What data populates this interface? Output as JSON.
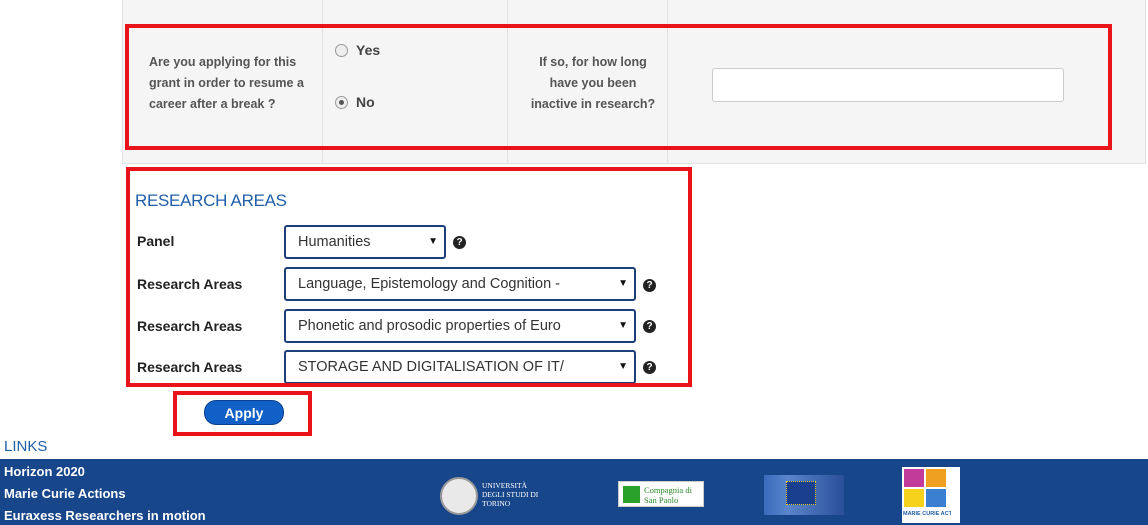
{
  "career_break": {
    "question": "Are you applying for this grant in order to resume a career after a break ?",
    "option_yes": "Yes",
    "option_no": "No",
    "selected": "No",
    "inactive_question": "If so, for how long have you been inactive in research?",
    "inactive_value": ""
  },
  "research_areas": {
    "heading": "RESEARCH AREAS",
    "panel_label": "Panel",
    "panel_value": "Humanities",
    "area_label": "Research Areas",
    "areas": [
      "Language, Epistemology and Cognition -",
      "Phonetic and prosodic properties of Euro",
      "STORAGE AND DIGITALISATION OF IT/"
    ],
    "help_glyph": "?"
  },
  "apply_label": "Apply",
  "links": {
    "title": "LINKS",
    "items": [
      "Horizon 2020",
      "Marie Curie Actions",
      "Euraxess Researchers in motion"
    ]
  },
  "footer_logos": {
    "unito": "UNIVERSITÀ DEGLI STUDI DI TORINO",
    "compagnia": "Compagnia di San Paolo",
    "eu_flag_icon": "european-commission-flag-icon",
    "mca": "MARIE CURIE ACTIONS"
  },
  "colors": {
    "highlight": "#e8141a",
    "accent": "#1f5fa8",
    "footer": "#17468a",
    "button": "#1060c8"
  }
}
